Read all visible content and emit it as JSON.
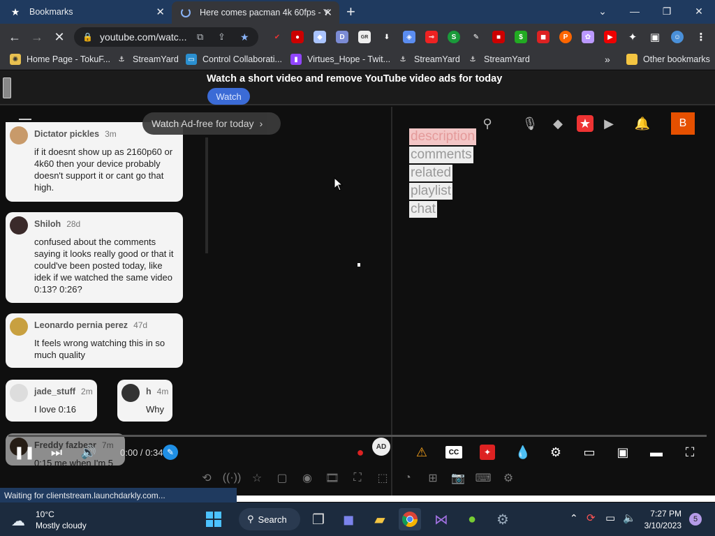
{
  "tabs": [
    {
      "title": "Bookmarks",
      "active": false
    },
    {
      "title": "Here comes pacman 4k 60fps - Y",
      "active": true
    }
  ],
  "address": "youtube.com/watc...",
  "bookmarks": [
    {
      "label": "Home Page - TokuF..."
    },
    {
      "label": "StreamYard"
    },
    {
      "label": "Control Collaborati..."
    },
    {
      "label": "Virtues_Hope - Twit..."
    },
    {
      "label": "StreamYard"
    },
    {
      "label": "StreamYard"
    }
  ],
  "other_bookmarks": "Other bookmarks",
  "ad_banner": {
    "title": "Watch a short video and remove YouTube video ads for today",
    "button": "Watch"
  },
  "adfree_pill": "Watch Ad-free for today",
  "comments": [
    {
      "author": "Dictator pickles",
      "age": "3m",
      "text": "if it doesnt show up as 2160p60 or 4k60 then your device probably doesn't support it or cant go that high."
    },
    {
      "author": "Shiloh",
      "age": "28d",
      "text": "confused about the comments saying it looks really good or that it could've been posted today, like idek if we watched the same video 0:13? 0:26?"
    },
    {
      "author": "Leonardo pernia perez",
      "age": "47d",
      "text": "It feels wrong watching this in so much quality"
    },
    {
      "author": "jade_stuff",
      "age": "2m",
      "text": "I love 0:16"
    },
    {
      "author": "h",
      "age": "4m",
      "text": "Why"
    },
    {
      "author": "Freddy fazbear",
      "age": "7m",
      "text": "0:15 me when I'm 5"
    }
  ],
  "side_links": [
    "description",
    "comments",
    "related",
    "playlist",
    "chat"
  ],
  "avatar_letter": "B",
  "player": {
    "time": "0:00 / 0:34",
    "progress": 0.0
  },
  "status_text": "Waiting for clientstream.launchdarkly.com...",
  "taskbar": {
    "weather_temp": "10°C",
    "weather_desc": "Mostly cloudy",
    "search": "Search",
    "time": "7:27 PM",
    "date": "3/10/2023",
    "notif_count": "5"
  },
  "colors": {
    "tab_strip": "#1f3a5f",
    "toolbar": "#35363a",
    "avatar": "#e65000",
    "watch_button": "#3b6bd6",
    "taskbar": "#1c2b3e"
  }
}
